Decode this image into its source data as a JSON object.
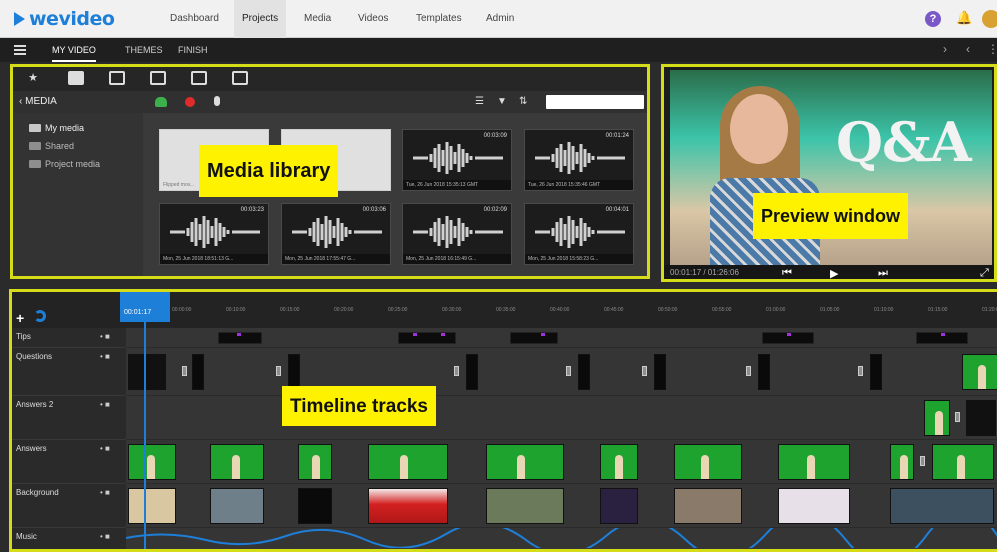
{
  "app": {
    "logo_text": "wevideo"
  },
  "topnav": {
    "links": [
      {
        "label": "Dashboard",
        "active": false
      },
      {
        "label": "Projects",
        "active": true
      },
      {
        "label": "Media",
        "active": false
      },
      {
        "label": "Videos",
        "active": false
      },
      {
        "label": "Templates",
        "active": false
      },
      {
        "label": "Admin",
        "active": false
      }
    ],
    "help_icon": "?",
    "bell_icon": "🔔"
  },
  "projectbar": {
    "tabs": [
      {
        "label": "MY VIDEO",
        "active": true
      },
      {
        "label": "THEMES",
        "active": false
      },
      {
        "label": "FINISH",
        "active": false
      }
    ],
    "controls": {
      "redo": "›",
      "undo": "‹",
      "more": "⋮"
    }
  },
  "media": {
    "tab_icons": [
      "star-icon",
      "folder-icon",
      "layers-icon",
      "stack-icon",
      "transition-icon",
      "text-icon"
    ],
    "title": "‹ MEDIA",
    "folders": [
      "My media",
      "Shared",
      "Project media"
    ],
    "toolbar": {
      "list": "☰",
      "filter": "▼",
      "sort": "⇅"
    },
    "audio_thumbs": [
      {
        "dur": "00:03:09",
        "caption": "Tue, 26 Jun 2018 15:35:13 GMT"
      },
      {
        "dur": "00:01:24",
        "caption": "Tue, 26 Jun 2018 15:35:46 GMT"
      },
      {
        "dur": "00:03:23",
        "caption": "Mon, 25 Jun 2018 18:51:13 G..."
      },
      {
        "dur": "00:03:06",
        "caption": "Mon, 25 Jun 2018 17:55:47 G..."
      },
      {
        "dur": "00:02:09",
        "caption": "Mon, 25 Jun 2018 16:15:49 G..."
      },
      {
        "dur": "00:04:01",
        "caption": "Mon, 25 Jun 2018 15:58:23 G..."
      }
    ],
    "folder_thumb_caption": "Flipped mov..."
  },
  "callouts": {
    "media_library": "Media library",
    "preview_window": "Preview window",
    "timeline_tracks": "Timeline tracks"
  },
  "preview": {
    "overlay_text": "Q&A",
    "time": "00:01:17 / 01:26:06",
    "controls": {
      "prev": "⏮",
      "play": "▶",
      "next": "⏭",
      "fullscreen": "⤢"
    }
  },
  "timeline": {
    "playhead_time": "00:01:17",
    "ticks": [
      "00:00:00",
      "00:10:00",
      "00:15:00",
      "00:20:00",
      "00:25:00",
      "00:30:00",
      "00:35:00",
      "00:40:00",
      "00:45:00",
      "00:50:00",
      "00:55:00",
      "01:00:00",
      "01:05:00",
      "01:10:00",
      "01:15:00",
      "01:20:00"
    ],
    "tracks": [
      "Tips",
      "Questions",
      "Answers 2",
      "Answers",
      "Background",
      "Music"
    ],
    "track_ctl": "• ■"
  },
  "colors": {
    "accent_blue": "#1e7fd8",
    "highlight_yellow": "#fff200",
    "panel_border": "#d4dd18",
    "chroma_green": "#1ea42e"
  }
}
